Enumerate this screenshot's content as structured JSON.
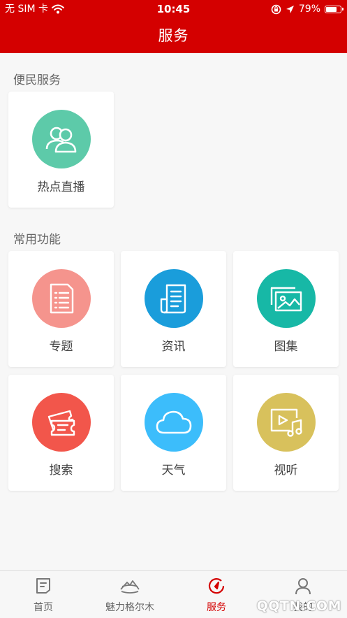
{
  "status_bar": {
    "carrier": "无 SIM 卡",
    "time": "10:45",
    "battery": "79%",
    "battery_level": 0.79,
    "icons": [
      "wifi-icon",
      "rotation-lock-icon",
      "location-arrow-icon",
      "battery-icon"
    ]
  },
  "header": {
    "title": "服务"
  },
  "sections": [
    {
      "title": "便民服务",
      "items": [
        {
          "label": "热点直播",
          "icon": "live-users-icon",
          "color": "#5dcaa9"
        }
      ]
    },
    {
      "title": "常用功能",
      "items": [
        {
          "label": "专题",
          "icon": "document-list-icon",
          "color": "#f5948d"
        },
        {
          "label": "资讯",
          "icon": "newspaper-icon",
          "color": "#1a9ddb"
        },
        {
          "label": "图集",
          "icon": "photo-gallery-icon",
          "color": "#17b8a6"
        },
        {
          "label": "搜索",
          "icon": "ticket-icon",
          "color": "#f2564b"
        },
        {
          "label": "天气",
          "icon": "cloud-icon",
          "color": "#3cbdfb"
        },
        {
          "label": "视听",
          "icon": "video-music-icon",
          "color": "#d8c15c"
        }
      ]
    }
  ],
  "tabbar": {
    "tabs": [
      {
        "label": "首页",
        "icon": "home-doc-icon",
        "active": false
      },
      {
        "label": "魅力格尔木",
        "icon": "mountain-icon",
        "active": false
      },
      {
        "label": "服务",
        "icon": "service-compass-icon",
        "active": true
      },
      {
        "label": "我的",
        "icon": "profile-icon",
        "active": false
      }
    ],
    "active_color": "#d40000",
    "inactive_color": "#777777"
  },
  "watermark": "QQTN.COM",
  "colors": {
    "header_bg": "#d40000",
    "page_bg": "#f7f7f7"
  }
}
